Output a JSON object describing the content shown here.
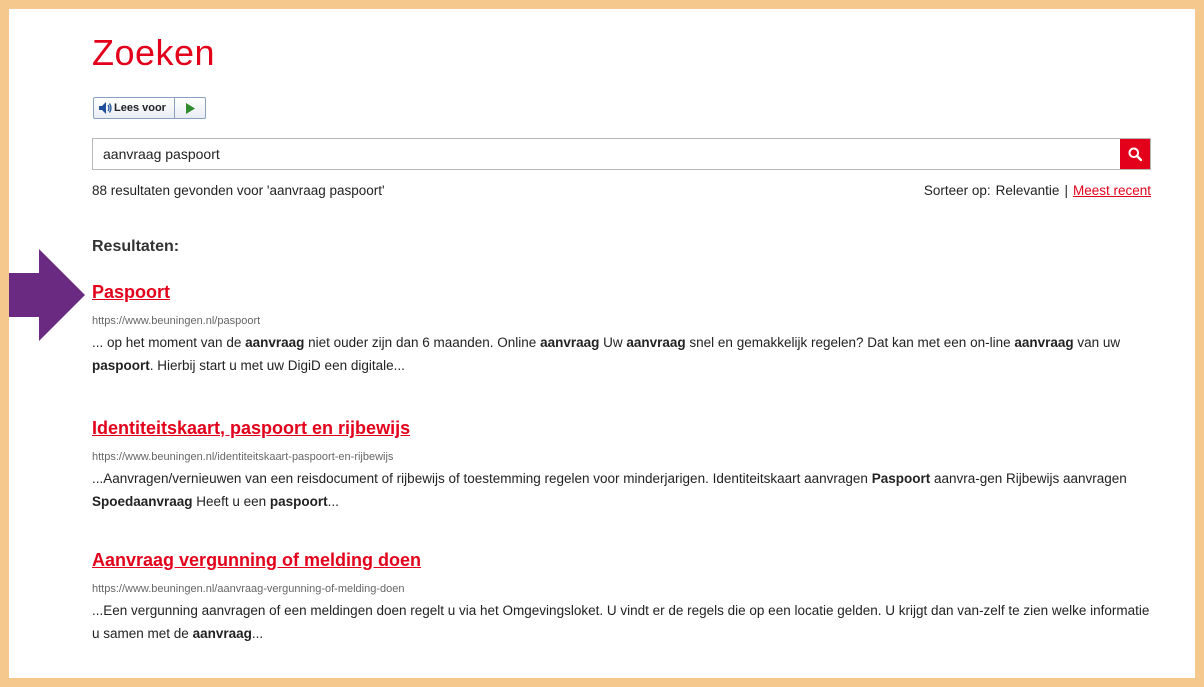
{
  "page": {
    "title": "Zoeken"
  },
  "readspeaker": {
    "listen_label": "Lees voor",
    "speaker_icon": "speaker-icon",
    "play_icon": "play-icon"
  },
  "search": {
    "value": "aanvraag paspoort",
    "button_icon": "search-icon"
  },
  "summary": {
    "count_text": "88 resultaten gevonden voor 'aanvraag paspoort'",
    "sort_label": "Sorteer op:",
    "sort_current": "Relevantie",
    "sort_separator": "|",
    "sort_alternative": "Meest recent"
  },
  "results_heading": "Resultaten:",
  "results": [
    {
      "title": "Paspoort",
      "url": "https://www.beuningen.nl/paspoort",
      "snippet": [
        [
          "... op het moment van de ",
          false
        ],
        [
          "aanvraag",
          true
        ],
        [
          " niet ouder zijn dan 6 maanden. Online ",
          false
        ],
        [
          "aanvraag",
          true
        ],
        [
          " Uw ",
          false
        ],
        [
          "aanvraag",
          true
        ],
        [
          " snel en gemakkelijk regelen? Dat kan met een on-line ",
          false
        ],
        [
          "aanvraag",
          true
        ],
        [
          " van uw ",
          false
        ],
        [
          "paspoort",
          true
        ],
        [
          ". Hierbij start u met uw DigiD een digitale...",
          false
        ]
      ]
    },
    {
      "title": "Identiteitskaart, paspoort en rijbewijs",
      "url": "https://www.beuningen.nl/identiteitskaart-paspoort-en-rijbewijs",
      "snippet": [
        [
          "...Aanvragen/vernieuwen van een reisdocument of rijbewijs of toestemming regelen voor minderjarigen. Identiteitskaart aanvragen ",
          false
        ],
        [
          "Paspoort",
          true
        ],
        [
          " aanvra-gen Rijbewijs aanvragen ",
          false
        ],
        [
          "Spoedaanvraag",
          true
        ],
        [
          " Heeft u een ",
          false
        ],
        [
          "paspoort",
          true
        ],
        [
          "...",
          false
        ]
      ]
    },
    {
      "title": "Aanvraag vergunning of melding doen",
      "url": "https://www.beuningen.nl/aanvraag-vergunning-of-melding-doen",
      "snippet": [
        [
          "...Een vergunning aanvragen of een meldingen doen regelt u via het Omgevingsloket. U vindt er de regels die op een locatie gelden. U krijgt dan van-zelf te zien welke informatie u samen met de ",
          false
        ],
        [
          "aanvraag",
          true
        ],
        [
          "...",
          false
        ]
      ]
    }
  ],
  "colors": {
    "accent": "#e3001b",
    "frame": "#f5c98e",
    "arrow": "#6b2a82"
  }
}
